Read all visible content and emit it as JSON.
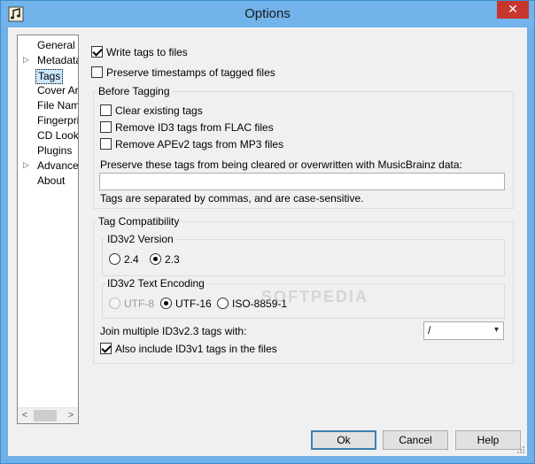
{
  "window": {
    "title": "Options",
    "close_glyph": "✕",
    "app_icon": "music-note-icon"
  },
  "sidebar": {
    "items": [
      {
        "label": "General",
        "expandable": false,
        "selected": false
      },
      {
        "label": "Metadata",
        "expandable": true,
        "selected": false
      },
      {
        "label": "Tags",
        "expandable": false,
        "selected": true
      },
      {
        "label": "Cover Art",
        "expandable": false,
        "selected": false
      },
      {
        "label": "File Naming",
        "expandable": false,
        "selected": false
      },
      {
        "label": "Fingerprinting",
        "expandable": false,
        "selected": false
      },
      {
        "label": "CD Lookup",
        "expandable": false,
        "selected": false
      },
      {
        "label": "Plugins",
        "expandable": false,
        "selected": false
      },
      {
        "label": "Advanced",
        "expandable": true,
        "selected": false
      },
      {
        "label": "About",
        "expandable": false,
        "selected": false
      }
    ],
    "scroll_left": "<",
    "scroll_right": ">"
  },
  "tags": {
    "write_tags": {
      "label": "Write tags to files",
      "checked": true
    },
    "preserve_timestamps": {
      "label": "Preserve timestamps of tagged files",
      "checked": false
    },
    "before_tagging": {
      "title": "Before Tagging",
      "clear_existing": {
        "label": "Clear existing tags",
        "checked": false
      },
      "remove_id3": {
        "label": "Remove ID3 tags from FLAC files",
        "checked": false
      },
      "remove_apev2": {
        "label": "Remove APEv2 tags from MP3 files",
        "checked": false
      },
      "preserve_label": "Preserve these tags from being cleared or overwritten with MusicBrainz data:",
      "preserve_value": "",
      "hint": "Tags are separated by commas, and are case-sensitive."
    },
    "compat": {
      "title": "Tag Compatibility",
      "version": {
        "title": "ID3v2 Version",
        "opt_24": "2.4",
        "opt_23": "2.3",
        "selected": "2.3"
      },
      "encoding": {
        "title": "ID3v2 Text Encoding",
        "opt_utf8": "UTF-8",
        "opt_utf16": "UTF-16",
        "opt_iso": "ISO-8859-1",
        "selected": "UTF-16"
      },
      "join_label": "Join multiple ID3v2.3 tags with:",
      "join_value": "/",
      "id3v1": {
        "label": "Also include ID3v1 tags in the files",
        "checked": true
      }
    }
  },
  "buttons": {
    "ok": "Ok",
    "cancel": "Cancel",
    "help": "Help"
  },
  "watermark": "SOFTPEDIA"
}
